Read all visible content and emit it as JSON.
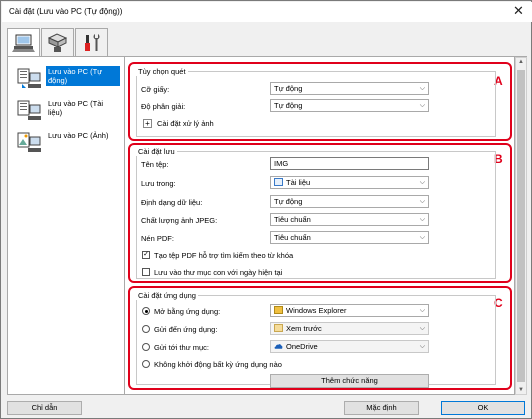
{
  "window": {
    "title": "Cài đặt (Lưu vào PC (Tự động))"
  },
  "tabs": [
    {
      "icon": "scan-from-computer-icon"
    },
    {
      "icon": "scan-from-panel-icon"
    },
    {
      "icon": "general-settings-tools-icon"
    }
  ],
  "sidebar": {
    "items": [
      {
        "label": "Lưu vào PC (Tự động)",
        "selected": true
      },
      {
        "label": "Lưu vào PC (Tài liệu)",
        "selected": false
      },
      {
        "label": "Lưu vào PC (Ảnh)",
        "selected": false
      }
    ]
  },
  "scan_options": {
    "title": "Tùy chọn quét",
    "marker": "A",
    "paper_size_label": "Cỡ giấy:",
    "paper_size_value": "Tự động",
    "resolution_label": "Độ phân giải:",
    "resolution_value": "Tự động",
    "image_processing_label": "Cài đặt xử lý ảnh",
    "expand_symbol": "+"
  },
  "save_settings": {
    "title": "Cài đặt lưu",
    "marker": "B",
    "file_name_label": "Tên tệp:",
    "file_name_value": "IMG",
    "save_in_label": "Lưu trong:",
    "save_in_value": "Tài liệu",
    "data_format_label": "Định dạng dữ liệu:",
    "data_format_value": "Tự động",
    "jpeg_quality_label": "Chất lượng ảnh JPEG:",
    "jpeg_quality_value": "Tiêu chuẩn",
    "pdf_compression_label": "Nén PDF:",
    "pdf_compression_value": "Tiêu chuẩn",
    "searchable_pdf_label": "Tạo tệp PDF hỗ trợ tìm kiếm theo từ khóa",
    "searchable_pdf_checked": true,
    "subfolder_label": "Lưu vào thư mục con với ngày hiện tại",
    "subfolder_checked": false
  },
  "app_settings": {
    "title": "Cài đặt ứng dụng",
    "marker": "C",
    "open_with_label": "Mở bằng ứng dụng:",
    "open_with_value": "Windows Explorer",
    "send_to_app_label": "Gửi đến ứng dụng:",
    "send_to_app_value": "Xem trước",
    "send_to_folder_label": "Gửi tới thư mục:",
    "send_to_folder_value": "OneDrive",
    "no_app_label": "Không khởi động bất kỳ ứng dụng nào",
    "selected_option": "open_with",
    "more_functions_label": "Thêm chức năng"
  },
  "footer": {
    "instructions_label": "Chỉ dẫn",
    "defaults_label": "Mặc định",
    "ok_label": "OK"
  },
  "colors": {
    "accent": "#0078d7",
    "marker_red": "#e0001b"
  }
}
